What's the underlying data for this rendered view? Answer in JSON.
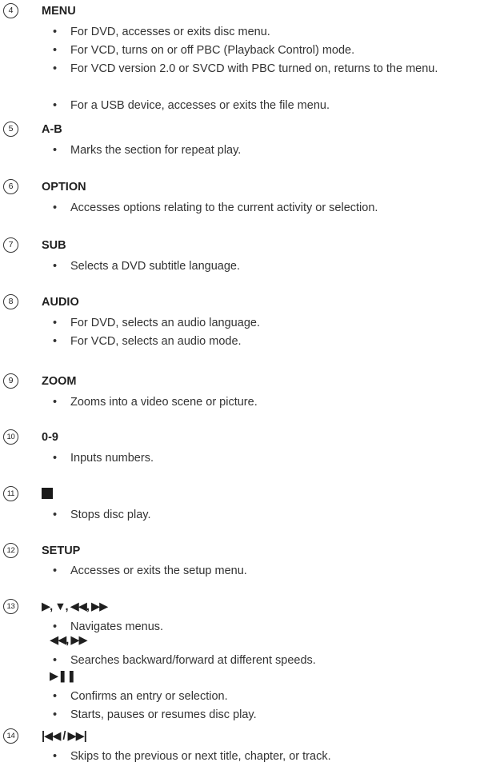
{
  "items": [
    {
      "num": "4",
      "label": "MENU",
      "bullets": [
        "For DVD, accesses or exits disc menu.",
        "For VCD, turns on or off PBC (Playback Control) mode.",
        "For VCD version 2.0 or SVCD with PBC turned on, returns to the menu.",
        "For a USB device, accesses or exits the file menu."
      ]
    },
    {
      "num": "5",
      "label": "A-B",
      "bullets": [
        "Marks the section for repeat play."
      ]
    },
    {
      "num": "6",
      "label": "OPTION",
      "bullets": [
        "Accesses options relating to the current activity or selection."
      ]
    },
    {
      "num": "7",
      "label": "SUB",
      "bullets": [
        "Selects a DVD subtitle language."
      ]
    },
    {
      "num": "8",
      "label": "AUDIO",
      "bullets": [
        "For DVD, selects an audio language.",
        "For VCD, selects an audio mode."
      ]
    },
    {
      "num": "9",
      "label": "ZOOM",
      "bullets": [
        "Zooms into a video scene or picture."
      ]
    },
    {
      "num": "10",
      "label": "0-9",
      "bullets": [
        "Inputs numbers."
      ]
    },
    {
      "num": "11",
      "icon": "stop-square-icon",
      "bullets": [
        "Stops disc play."
      ]
    },
    {
      "num": "12",
      "label": "SETUP",
      "bullets": [
        "Accesses or exits the setup menu."
      ]
    },
    {
      "num": "13",
      "label": "▶, ▼, ◀◀, ▶▶",
      "bullets": [
        "Navigates menus."
      ]
    },
    {
      "sub": "◀◀, ▶▶",
      "bullets": [
        "Searches backward/forward at different speeds."
      ]
    },
    {
      "sub": "▶❚❚",
      "bullets": [
        "Confirms an entry or selection.",
        "Starts, pauses or resumes disc play."
      ]
    },
    {
      "num": "14",
      "label": "|◀◀ / ▶▶|",
      "bullets": [
        "Skips to the previous or next title, chapter, or track."
      ]
    }
  ],
  "bullet_char": "•"
}
